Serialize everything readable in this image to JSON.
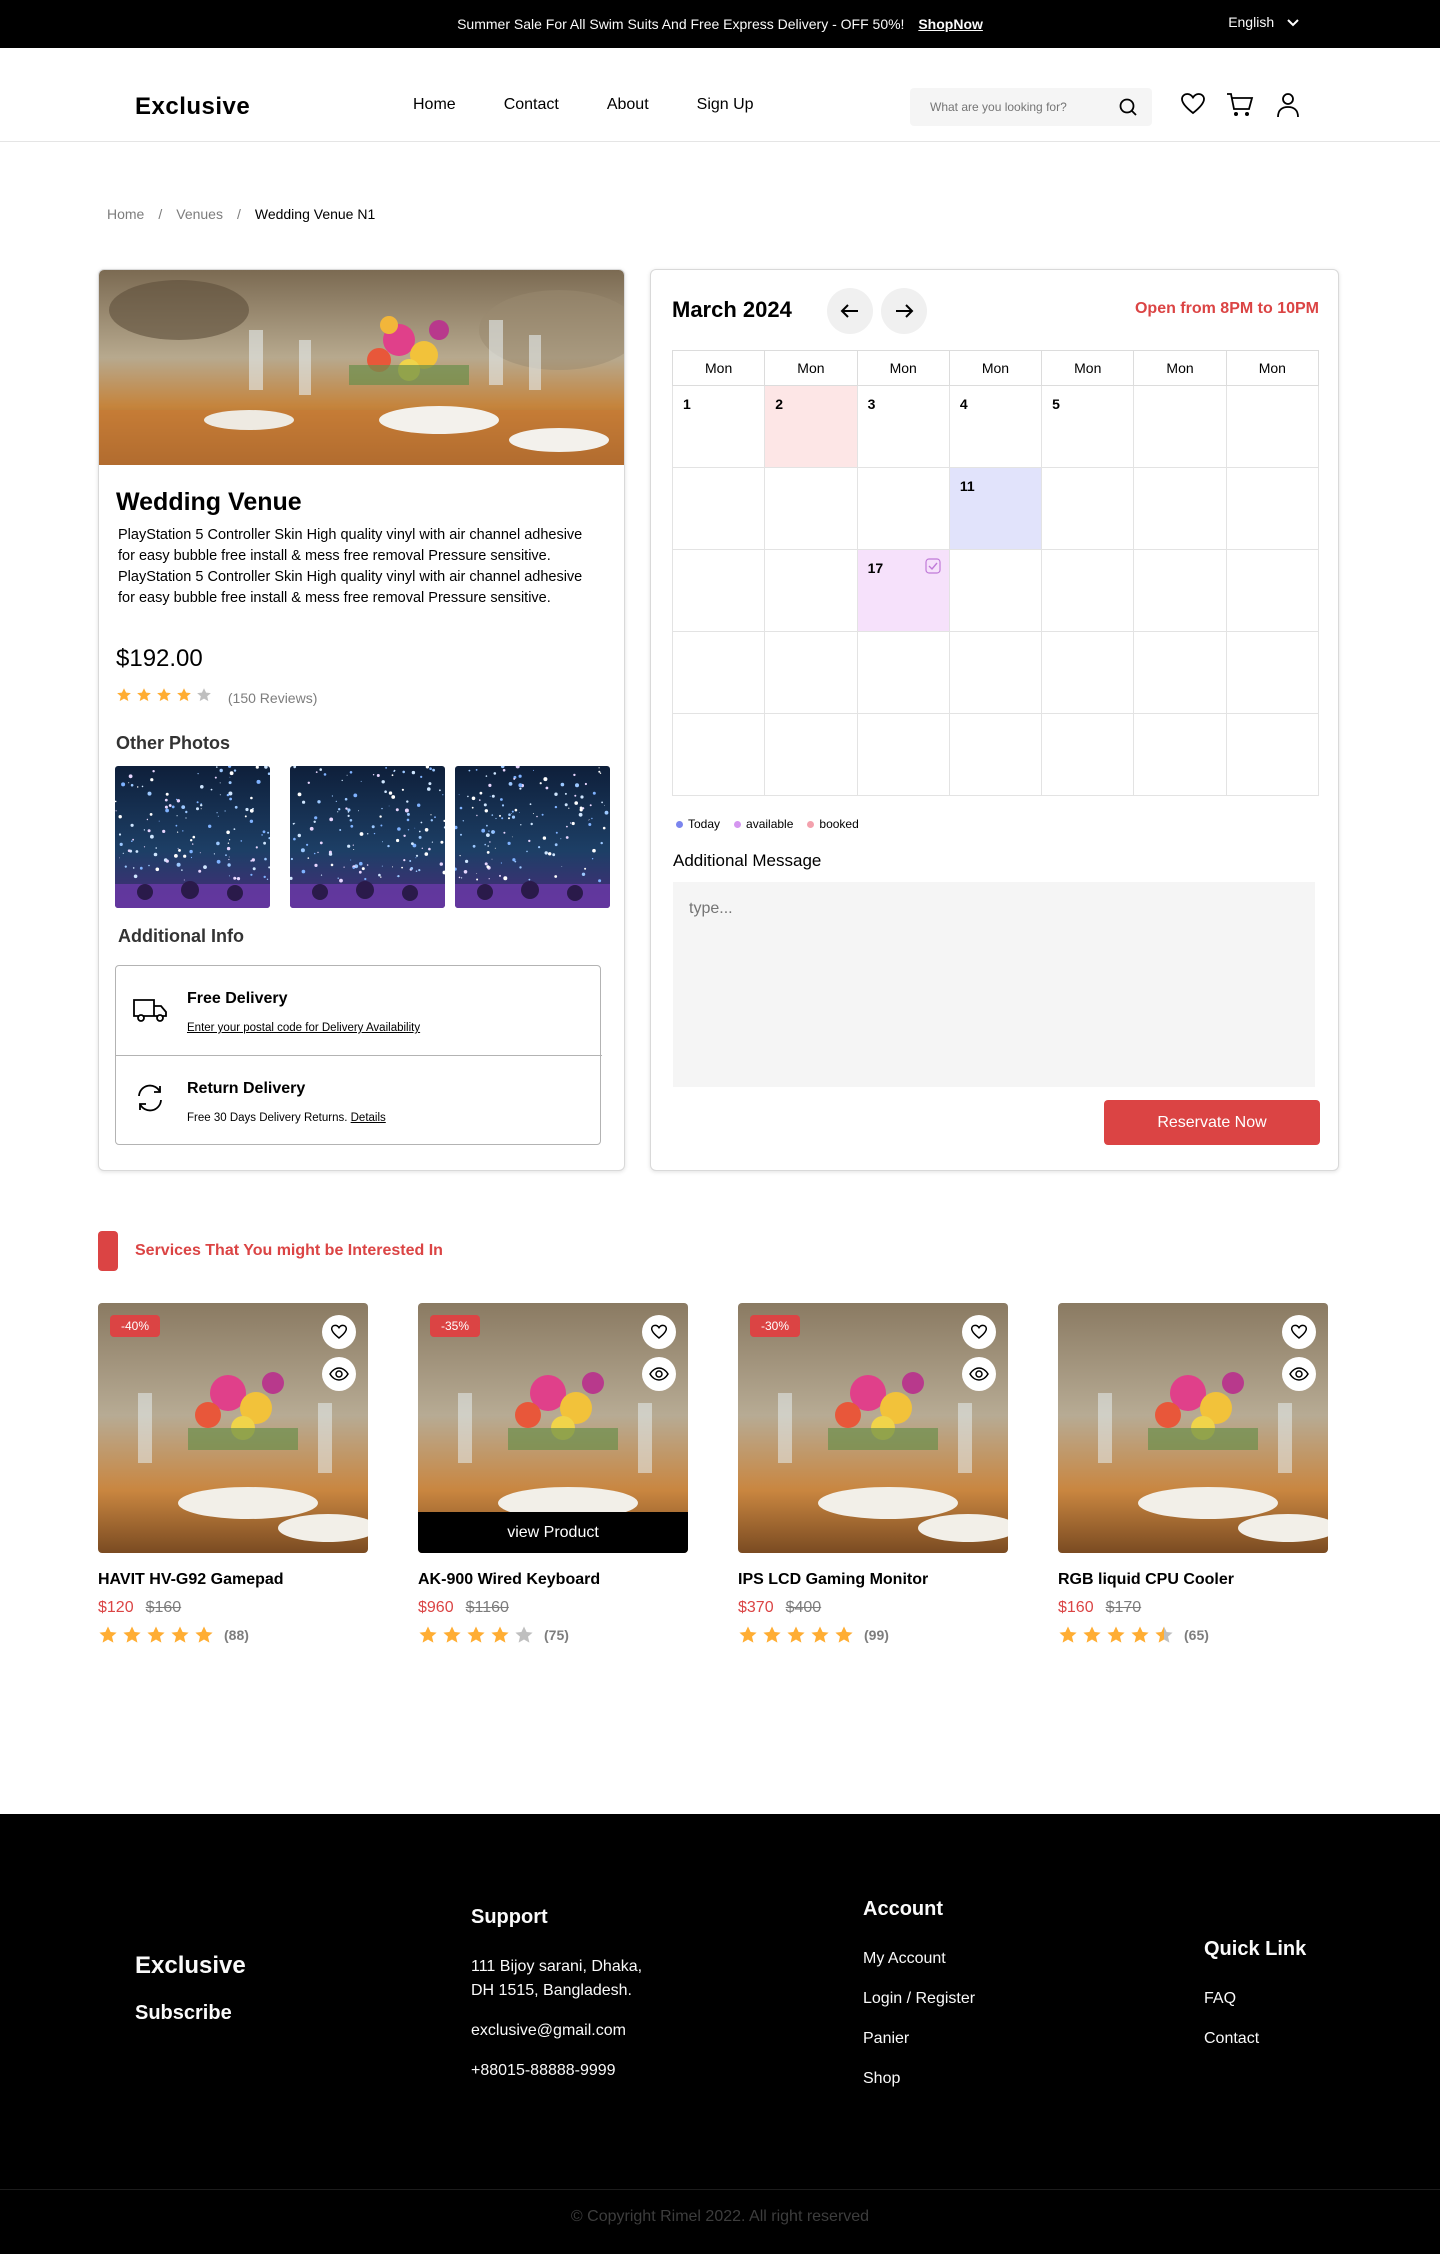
{
  "topbar": {
    "message": "Summer Sale For All Swim Suits And Free Express Delivery - OFF 50%!",
    "link": "ShopNow",
    "language": "English"
  },
  "header": {
    "logo": "Exclusive",
    "nav": [
      "Home",
      "Contact",
      "About",
      "Sign Up"
    ],
    "search_placeholder": "What are you looking for?"
  },
  "breadcrumb": [
    "Home",
    "Venues",
    "Wedding Venue N1"
  ],
  "venue": {
    "title": "Wedding Venue",
    "description": "PlayStation 5 Controller Skin High quality vinyl with air channel adhesive for easy bubble free install & mess free removal Pressure sensitive. PlayStation 5 Controller Skin High quality vinyl with air channel adhesive for easy bubble free install & mess free removal Pressure sensitive.",
    "price": "$192.00",
    "rating": 4,
    "reviews": "(150 Reviews)",
    "other_photos_title": "Other Photos",
    "additional_info_title": "Additional Info",
    "free_delivery_title": "Free Delivery",
    "free_delivery_sub": "Enter your postal code for Delivery Availability",
    "return_title": "Return Delivery",
    "return_sub": "Free 30 Days Delivery Returns.",
    "return_link": "Details"
  },
  "calendar": {
    "month": "March 2024",
    "open_hours": "Open from 8PM to 10PM",
    "weekdays": [
      "Mon",
      "Mon",
      "Mon",
      "Mon",
      "Mon",
      "Mon",
      "Mon"
    ],
    "rows": [
      [
        "1",
        "2",
        "3",
        "4",
        "5",
        "",
        ""
      ],
      [
        "",
        "",
        "",
        "11",
        "",
        "",
        ""
      ],
      [
        "",
        "",
        "17",
        "",
        "",
        "",
        ""
      ],
      [
        "",
        "",
        "",
        "",
        "",
        "",
        ""
      ],
      [
        "",
        "",
        "",
        "",
        "",
        "",
        ""
      ]
    ],
    "legend": [
      "Today",
      "available",
      "booked"
    ],
    "colors": {
      "today": "#7b85ee",
      "available": "#d596f0",
      "booked": "#f3a1ad"
    },
    "message_label": "Additional Message",
    "message_placeholder": "type...",
    "reserve_button": "Reservate Now"
  },
  "section_title": "Services That You might be Interested In",
  "products": [
    {
      "name": "HAVIT HV-G92 Gamepad",
      "price": "$120",
      "old": "$160",
      "discount": "-40%",
      "rating": 5,
      "reviews": "(88)"
    },
    {
      "name": "AK-900 Wired Keyboard",
      "price": "$960",
      "old": "$1160",
      "discount": "-35%",
      "rating": 4,
      "reviews": "(75)",
      "view": "view Product"
    },
    {
      "name": "IPS LCD Gaming Monitor",
      "price": "$370",
      "old": "$400",
      "discount": "-30%",
      "rating": 5,
      "reviews": "(99)"
    },
    {
      "name": "RGB liquid CPU Cooler",
      "price": "$160",
      "old": "$170",
      "discount": "",
      "rating": 4.5,
      "reviews": "(65)"
    }
  ],
  "footer": {
    "logo": "Exclusive",
    "subscribe": "Subscribe",
    "support_title": "Support",
    "address_1": "111 Bijoy sarani, Dhaka,",
    "address_2": "DH 1515, Bangladesh.",
    "email": "exclusive@gmail.com",
    "phone": "+88015-88888-9999",
    "account_title": "Account",
    "account_links": [
      "My Account",
      "Login / Register",
      "Panier",
      "Shop"
    ],
    "quick_title": "Quick Link",
    "quick_links": [
      "FAQ",
      "Contact"
    ],
    "copyright": "Copyright Rimel 2022. All right reserved"
  },
  "accent": "#db4444"
}
